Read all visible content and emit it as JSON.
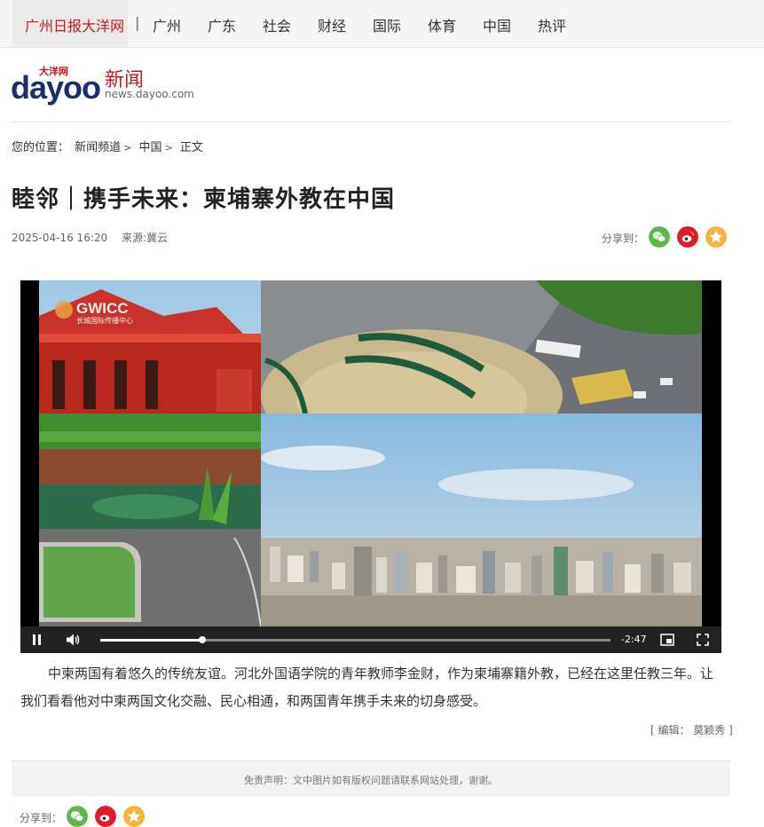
{
  "topnav": {
    "home": "广州日报大洋网",
    "separator": "|",
    "items": [
      "广州",
      "广东",
      "社会",
      "财经",
      "国际",
      "体育",
      "中国",
      "热评"
    ]
  },
  "logo": {
    "brand": "dayoo",
    "brand_cn": "大洋网",
    "section": "新闻",
    "domain": "news.dayoo.com"
  },
  "breadcrumb": {
    "label": "您的位置：",
    "items": [
      "新闻频道",
      "中国",
      "正文"
    ],
    "arrow": ">"
  },
  "article": {
    "title": "睦邻｜携手未来：柬埔寨外教在中国",
    "date": "2025-04-16 16:20",
    "source": "来源:冀云",
    "body": "中柬两国有着悠久的传统友谊。河北外国语学院的青年教师李金财，作为柬埔寨籍外教，已经在这里任教三年。让我们看看他对中柬两国文化交融、民心相通，和两国青年携手未来的切身感受。",
    "editor": "[ 编辑：  莫颖秀 ]"
  },
  "share": {
    "label": "分享到：",
    "icons": [
      "wechat-icon",
      "weibo-icon",
      "qzone-icon"
    ],
    "colors": {
      "wechat": "#5fb64b",
      "weibo": "#e6162d",
      "qzone": "#f5b43b"
    }
  },
  "video": {
    "watermark": "GWICC",
    "watermark_sub": "长城国际传播中心",
    "time_remaining": "-2:47",
    "progress": 0.2
  },
  "disclaimer": "免责声明：文中图片如有版权问题请联系网站处理，谢谢。"
}
